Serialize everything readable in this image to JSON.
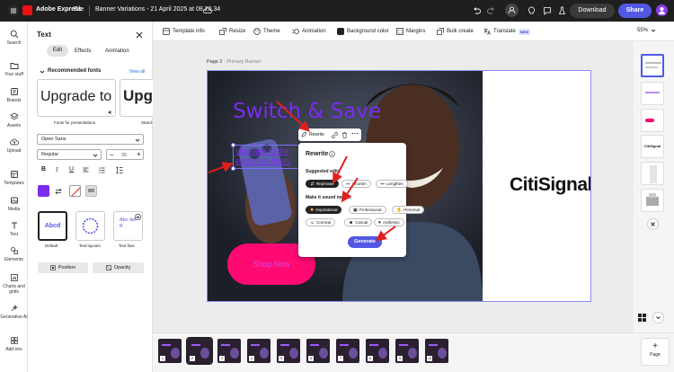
{
  "app": {
    "name": "Adobe Express",
    "file_menu": "File",
    "doc_title": "Banner Variations - 21 April 2025 at 08.20.34"
  },
  "header": {
    "download": "Download",
    "share": "Share"
  },
  "rail": [
    {
      "icon": "search-icon",
      "label": "Search"
    },
    {
      "icon": "folder-icon",
      "label": "Your stuff"
    },
    {
      "icon": "brand-icon",
      "label": "Brands"
    },
    {
      "icon": "assets-icon",
      "label": "Assets"
    },
    {
      "icon": "upload-icon",
      "label": "Upload"
    },
    {
      "icon": "templates-icon",
      "label": "Templates"
    },
    {
      "icon": "media-icon",
      "label": "Media"
    },
    {
      "icon": "text-icon",
      "label": "Text"
    },
    {
      "icon": "elements-icon",
      "label": "Elements"
    },
    {
      "icon": "charts-icon",
      "label": "Charts and grids"
    },
    {
      "icon": "ai-icon",
      "label": "Generative AI"
    },
    {
      "icon": "addons-icon",
      "label": "Add-ons"
    }
  ],
  "panel": {
    "title": "Text",
    "tabs": [
      "Edit",
      "Effects",
      "Animation"
    ],
    "recommended": "Recommended fonts",
    "view_all": "View all",
    "font_card1": "Upgrade to t",
    "font_card2": "Upgr",
    "font_card1_caption": "Fonts for presentations",
    "font_card2_caption": "Stand-",
    "font_family": "Open Sans",
    "font_style": "Regular",
    "font_size": "35",
    "text_layouts": [
      {
        "sample": "Abcd",
        "label": "Default"
      },
      {
        "sample": "",
        "label": "Text layouts"
      },
      {
        "sample": "Abc def g",
        "label": "Text flow"
      }
    ],
    "position": "Position",
    "opacity": "Opacity",
    "text_color": "#7a2cf0"
  },
  "toolbar": [
    {
      "icon": "template-icon",
      "label": "Template info"
    },
    {
      "icon": "resize-icon",
      "label": "Resize"
    },
    {
      "icon": "theme-icon",
      "label": "Theme"
    },
    {
      "icon": "animation-icon",
      "label": "Animation"
    },
    {
      "icon": "bg-color-icon",
      "label": "Background color"
    },
    {
      "icon": "margins-icon",
      "label": "Margins"
    },
    {
      "icon": "bulk-icon",
      "label": "Bulk create"
    },
    {
      "icon": "translate-icon",
      "label": "Translate"
    }
  ],
  "toolbar_new_badge": "NEW",
  "zoom": "55%",
  "page": {
    "label": "Page 2",
    "name": "Primary Banner"
  },
  "banner": {
    "headline": "Switch & Save",
    "body_line1": "Upgrade to the",
    "body_line2": "exclusive deals",
    "cta": "Shop Now",
    "brand": "CitiSignal",
    "headline_color": "#7a2cf0",
    "cta_color": "#ff0a73"
  },
  "context_menu": {
    "rewrite": "Rewrite"
  },
  "rewrite": {
    "title": "Rewrite",
    "suggested": "Suggested edits",
    "edits": [
      "Rephrase",
      "Shorten",
      "Lengthen"
    ],
    "sound": "Make it sound more...",
    "tones": [
      "Inspirational",
      "Professional",
      "Personal",
      "Comical",
      "Casual",
      "Authentic"
    ],
    "generate": "Generate"
  },
  "add_page": "Page",
  "page_count": 10
}
